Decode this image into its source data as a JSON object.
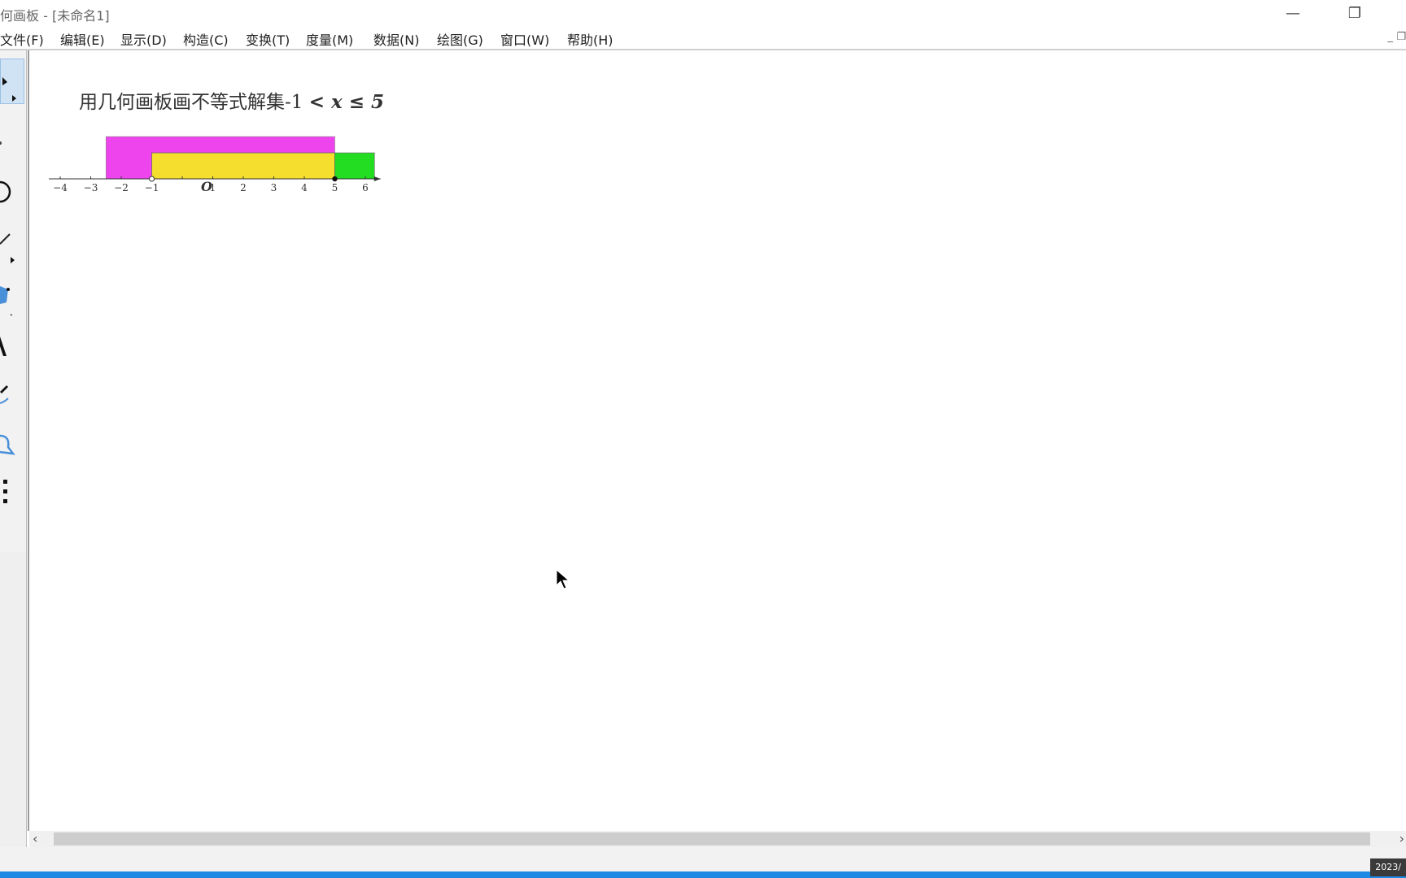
{
  "window": {
    "title": "何画板 - [未命名1]",
    "controls": {
      "minimize": "—",
      "restore": "❐",
      "close": "✕"
    }
  },
  "menu": {
    "items": [
      {
        "label": "文件(F)"
      },
      {
        "label": "编辑(E)"
      },
      {
        "label": "显示(D)"
      },
      {
        "label": "构造(C)"
      },
      {
        "label": "变换(T)"
      },
      {
        "label": "度量(M)"
      },
      {
        "label": "数据(N)"
      },
      {
        "label": "绘图(G)"
      },
      {
        "label": "窗口(W)"
      },
      {
        "label": "帮助(H)"
      }
    ],
    "doc_minimize": "_",
    "doc_restore": "❐"
  },
  "toolbox": {
    "tools": [
      {
        "icon": "arrow-select-icon",
        "active": true
      },
      {
        "icon": "point-icon"
      },
      {
        "icon": "compass-circle-icon"
      },
      {
        "icon": "straightedge-icon"
      },
      {
        "icon": "polygon-icon"
      },
      {
        "icon": "text-icon"
      },
      {
        "icon": "marker-pen-icon"
      },
      {
        "icon": "information-icon"
      },
      {
        "icon": "custom-tools-icon"
      }
    ]
  },
  "sketch": {
    "caption_prefix": "用几何画板画不等式解集-1 ",
    "caption_math": "< x ≤ 5",
    "number_line": {
      "ticks": [
        "−4",
        "−3",
        "−2",
        "−1",
        "O",
        "1",
        "2",
        "3",
        "4",
        "5",
        "6"
      ],
      "tick_values": [
        -4,
        -3,
        -2,
        -1,
        0,
        1,
        2,
        3,
        4,
        5,
        6
      ],
      "open_point": -1,
      "closed_point": 5,
      "magenta_range": [
        -2.5,
        5
      ],
      "yellow_range": [
        -1,
        5
      ],
      "green_range": [
        5,
        6.3
      ],
      "colors": {
        "magenta": "#ee44ee",
        "yellow": "#f5de2e",
        "green": "#22dd22"
      }
    }
  },
  "scrollbar": {
    "left_arrow": "‹",
    "right_arrow": "›"
  },
  "taskbar": {
    "clock": "2023/"
  }
}
